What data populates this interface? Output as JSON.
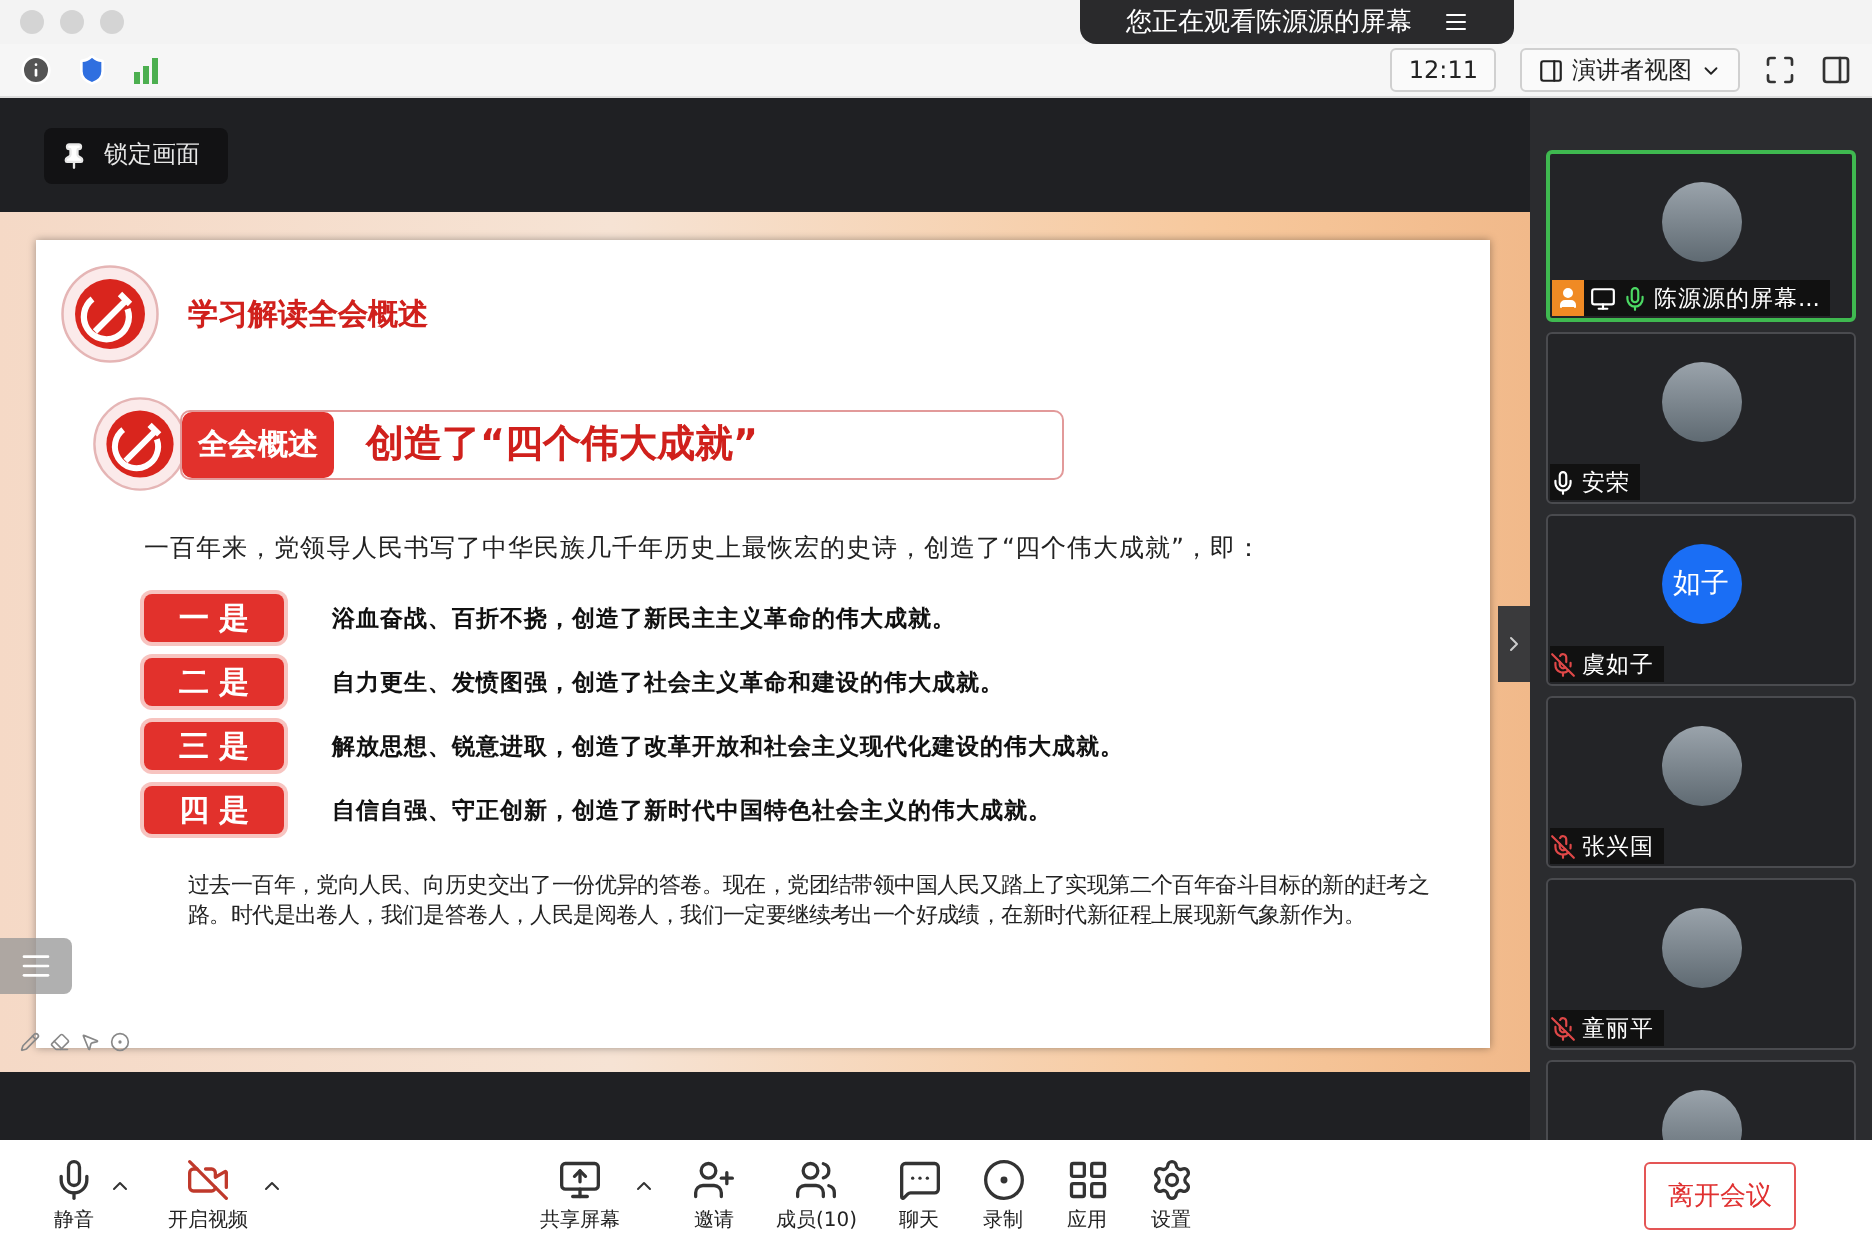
{
  "banner": {
    "text": "您正在观看陈源源的屏幕"
  },
  "topbar": {
    "time": "12:11",
    "view": "演讲者视图"
  },
  "lock_button": "锁定画面",
  "slide": {
    "title": "学习解读全会概述",
    "section_tag": "全会概述",
    "section_title": "创造了“四个伟大成就”",
    "intro": "一百年来，党领导人民书写了中华民族几千年历史上最恢宏的史诗，创造了“四个伟大成就”，即：",
    "points": [
      {
        "tag": "一 是",
        "text": "浴血奋战、百折不挠，创造了新民主主义革命的伟大成就。"
      },
      {
        "tag": "二 是",
        "text": "自力更生、发愤图强，创造了社会主义革命和建设的伟大成就。"
      },
      {
        "tag": "三 是",
        "text": "解放思想、锐意进取，创造了改革开放和社会主义现代化建设的伟大成就。"
      },
      {
        "tag": "四 是",
        "text": "自信自强、守正创新，创造了新时代中国特色社会主义的伟大成就。"
      }
    ],
    "closing": "过去一百年，党向人民、向历史交出了一份优异的答卷。现在，党团结带领中国人民又踏上了实现第二个百年奋斗目标的新的赶考之路。时代是出卷人，我们是答卷人，人民是阅卷人，我们一定要继续考出一个好成绩，在新时代新征程上展现新气象新作为。"
  },
  "participants": [
    {
      "name": "陈源源的屏幕...",
      "muted": false,
      "active": true,
      "host": true,
      "sharing": true,
      "avatar": {
        "kind": "photo"
      }
    },
    {
      "name": "安荣",
      "muted": false,
      "active": false,
      "host": false,
      "sharing": false,
      "avatar": {
        "kind": "photo"
      }
    },
    {
      "name": "虞如子",
      "muted": true,
      "active": false,
      "host": false,
      "sharing": false,
      "avatar": {
        "kind": "initials",
        "text": "如子"
      }
    },
    {
      "name": "张兴国",
      "muted": true,
      "active": false,
      "host": false,
      "sharing": false,
      "avatar": {
        "kind": "photo"
      }
    },
    {
      "name": "童丽平",
      "muted": true,
      "active": false,
      "host": false,
      "sharing": false,
      "avatar": {
        "kind": "photo"
      }
    }
  ],
  "toolbar_left": [
    {
      "kind": "mic",
      "label": "静音",
      "caret": true
    },
    {
      "kind": "video",
      "label": "开启视频",
      "caret": true
    }
  ],
  "toolbar_center": [
    {
      "kind": "share",
      "label": "共享屏幕",
      "caret": true
    },
    {
      "kind": "invite",
      "label": "邀请",
      "caret": false
    },
    {
      "kind": "members",
      "label": "成员(10)",
      "caret": false
    },
    {
      "kind": "chat",
      "label": "聊天",
      "caret": false
    },
    {
      "kind": "record",
      "label": "录制",
      "caret": false
    },
    {
      "kind": "apps",
      "label": "应用",
      "caret": false
    },
    {
      "kind": "settings",
      "label": "设置",
      "caret": false
    }
  ],
  "leave_button": "离开会议"
}
